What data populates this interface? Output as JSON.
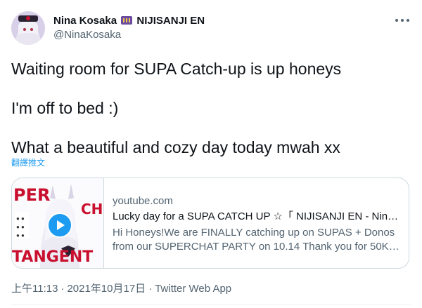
{
  "user": {
    "display_name": "Nina Kosaka",
    "org": "NIJISANJI EN",
    "handle": "@NinaKosaka"
  },
  "tweet": {
    "line1": "Waiting room for SUPA Catch-up is up honeys",
    "line2": "I'm off to bed :)",
    "line3": "What a beautiful and cozy day today mwah xx",
    "translate_label": "翻譯推文"
  },
  "card": {
    "domain": "youtube.com",
    "title": "Lucky day for a SUPA CATCH UP ☆「 NIJISANJI EN - Nina ...",
    "desc_line1": "Hi Honeys!We are FINALLY catching up on SUPAS + Donos",
    "desc_line2": "from our SUPERCHAT PARTY on 10.14 Thank you for 50K, ...",
    "thumb_words": {
      "per": "PER",
      "ch": "CH",
      "tangent": "TANGENT"
    }
  },
  "meta": {
    "time": "上午11:13",
    "separator": "·",
    "date": "2021年10月17日",
    "source": "Twitter Web App"
  },
  "colors": {
    "accent": "#1d9bf0",
    "muted": "#536471",
    "thumb_red": "#c8102e"
  },
  "icons": [
    "more-icon",
    "slot-machine-emoji-icon",
    "play-icon"
  ]
}
